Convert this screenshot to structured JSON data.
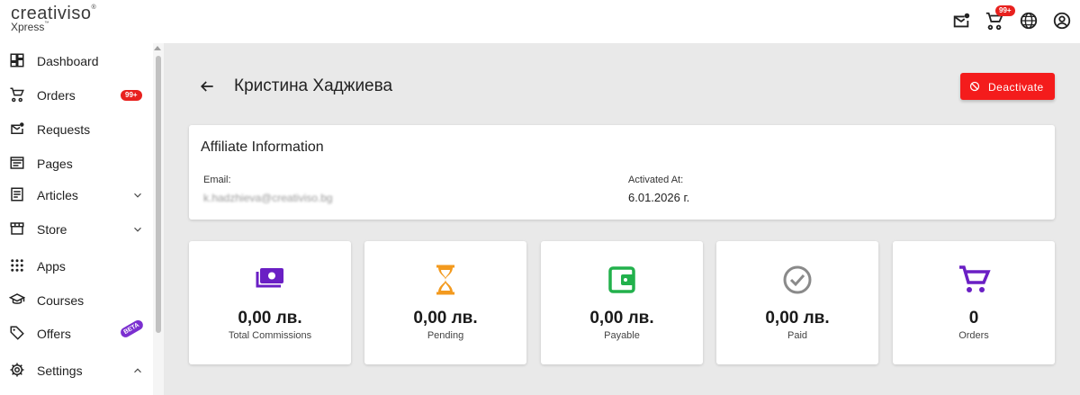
{
  "app": {
    "brand": "creativiso",
    "brand_mark": "®",
    "sub_brand": "Xpress",
    "sub_mark": "™"
  },
  "topbar": {
    "icons": [
      "mail-notification-icon",
      "cart-icon",
      "globe-icon",
      "account-icon"
    ],
    "cart_badge": "99+"
  },
  "sidebar": {
    "items": [
      {
        "label": "Dashboard",
        "icon": "dashboard-icon"
      },
      {
        "label": "Orders",
        "icon": "cart-icon",
        "badge": "99+"
      },
      {
        "label": "Requests",
        "icon": "mail-icon"
      },
      {
        "label": "Pages",
        "icon": "pages-icon"
      },
      {
        "label": "Articles",
        "icon": "articles-icon",
        "expand": "chevron-down"
      },
      {
        "label": "Store",
        "icon": "store-icon",
        "expand": "chevron-down"
      },
      {
        "label": "Apps",
        "icon": "apps-grid-icon"
      },
      {
        "label": "Courses",
        "icon": "school-icon"
      },
      {
        "label": "Offers",
        "icon": "tag-icon",
        "badge": "BETA"
      },
      {
        "label": "Settings",
        "icon": "gear-icon",
        "expand": "chevron-up"
      }
    ]
  },
  "header": {
    "title": "Кристина Хаджиева",
    "deactivate_label": "Deactivate"
  },
  "affiliate": {
    "title": "Affiliate Information",
    "email_label": "Email:",
    "email_value": "k.hadzhieva@creativiso.bg",
    "activated_label": "Activated At:",
    "activated_value": "6.01.2026 г."
  },
  "stats": [
    {
      "value": "0,00 лв.",
      "label": "Total Commissions",
      "icon": "money-icon",
      "color": "#6a1fc4"
    },
    {
      "value": "0,00 лв.",
      "label": "Pending",
      "icon": "hourglass-icon",
      "color": "#f39a1e"
    },
    {
      "value": "0,00 лв.",
      "label": "Payable",
      "icon": "wallet-icon",
      "color": "#22b14c"
    },
    {
      "value": "0,00 лв.",
      "label": "Paid",
      "icon": "check-circle-icon",
      "color": "#8a8a8a"
    },
    {
      "value": "0",
      "label": "Orders",
      "icon": "cart-icon",
      "color": "#6a1fc4"
    }
  ],
  "colors": {
    "accent_red": "#f41c1c",
    "badge_red": "#e8211e",
    "beta_purple": "#7b2fd0",
    "main_bg": "#e9e9e9"
  }
}
